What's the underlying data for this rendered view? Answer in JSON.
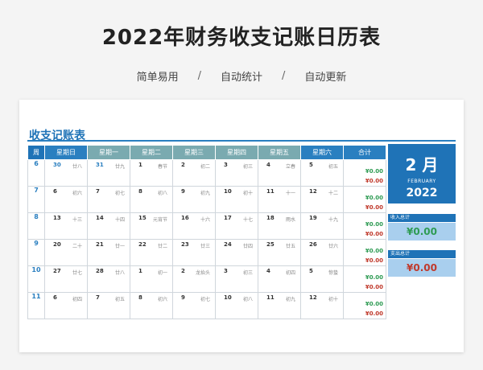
{
  "title": "2022年财务收支记账日历表",
  "subtitle": [
    "简单易用",
    "自动统计",
    "自动更新"
  ],
  "separator": "/",
  "sheet_title": "收支记账表",
  "headers": [
    "周",
    "星期日",
    "星期一",
    "星期二",
    "星期三",
    "星期四",
    "星期五",
    "星期六",
    "合计"
  ],
  "weeks": [
    {
      "week": "6",
      "days": [
        {
          "d": "30",
          "l": "廿八",
          "prev": true
        },
        {
          "d": "31",
          "l": "廿九",
          "prev": true
        },
        {
          "d": "1",
          "l": "春节"
        },
        {
          "d": "2",
          "l": "初二"
        },
        {
          "d": "3",
          "l": "初三"
        },
        {
          "d": "4",
          "l": "立春"
        },
        {
          "d": "5",
          "l": "初五"
        }
      ],
      "income": "¥0.00",
      "expense": "¥0.00"
    },
    {
      "week": "7",
      "days": [
        {
          "d": "6",
          "l": "初六"
        },
        {
          "d": "7",
          "l": "初七"
        },
        {
          "d": "8",
          "l": "初八"
        },
        {
          "d": "9",
          "l": "初九"
        },
        {
          "d": "10",
          "l": "初十"
        },
        {
          "d": "11",
          "l": "十一"
        },
        {
          "d": "12",
          "l": "十二"
        }
      ],
      "income": "¥0.00",
      "expense": "¥0.00"
    },
    {
      "week": "8",
      "days": [
        {
          "d": "13",
          "l": "十三"
        },
        {
          "d": "14",
          "l": "十四"
        },
        {
          "d": "15",
          "l": "元宵节"
        },
        {
          "d": "16",
          "l": "十六"
        },
        {
          "d": "17",
          "l": "十七"
        },
        {
          "d": "18",
          "l": "雨水"
        },
        {
          "d": "19",
          "l": "十九"
        }
      ],
      "income": "¥0.00",
      "expense": "¥0.00"
    },
    {
      "week": "9",
      "days": [
        {
          "d": "20",
          "l": "二十"
        },
        {
          "d": "21",
          "l": "廿一"
        },
        {
          "d": "22",
          "l": "廿二"
        },
        {
          "d": "23",
          "l": "廿三"
        },
        {
          "d": "24",
          "l": "廿四"
        },
        {
          "d": "25",
          "l": "廿五"
        },
        {
          "d": "26",
          "l": "廿六"
        }
      ],
      "income": "¥0.00",
      "expense": "¥0.00"
    },
    {
      "week": "10",
      "days": [
        {
          "d": "27",
          "l": "廿七"
        },
        {
          "d": "28",
          "l": "廿八"
        },
        {
          "d": "1",
          "l": "初一"
        },
        {
          "d": "2",
          "l": "龙抬头"
        },
        {
          "d": "3",
          "l": "初三"
        },
        {
          "d": "4",
          "l": "初四"
        },
        {
          "d": "5",
          "l": "惊蛰"
        }
      ],
      "income": "¥0.00",
      "expense": "¥0.00"
    },
    {
      "week": "11",
      "days": [
        {
          "d": "6",
          "l": "初四"
        },
        {
          "d": "7",
          "l": "初五"
        },
        {
          "d": "8",
          "l": "初六"
        },
        {
          "d": "9",
          "l": "初七"
        },
        {
          "d": "10",
          "l": "初八"
        },
        {
          "d": "11",
          "l": "初九"
        },
        {
          "d": "12",
          "l": "初十"
        }
      ],
      "income": "¥0.00",
      "expense": "¥0.00"
    }
  ],
  "month": {
    "label": "2 月",
    "en": "FEBRUARY",
    "year": "2022"
  },
  "summary": {
    "income_label": "收入总计",
    "income_value": "¥0.00",
    "expense_label": "支出总计",
    "expense_value": "¥0.00"
  },
  "colors": {
    "header_dark": "#2a7fc0",
    "header_light": "#7aaab0",
    "income": "#2e9b53",
    "expense": "#c0392b"
  }
}
